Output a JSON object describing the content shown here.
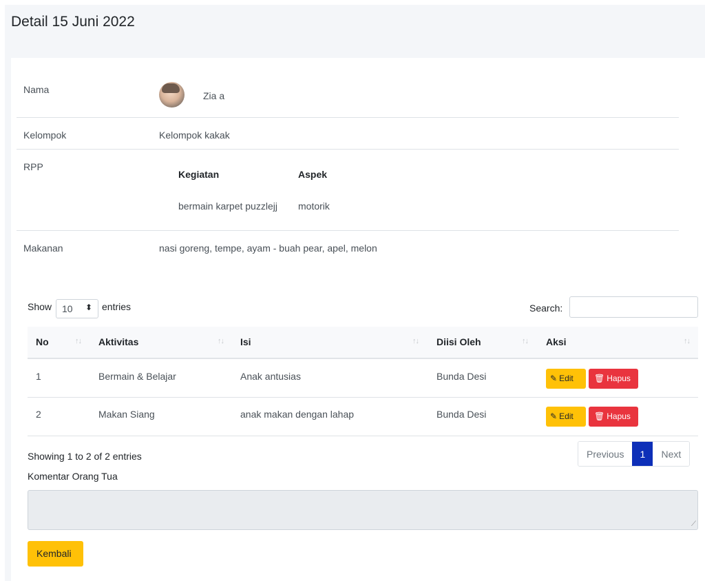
{
  "page": {
    "title": "Detail 15 Juni 2022"
  },
  "detail": {
    "nama_label": "Nama",
    "nama_value": "Zia a",
    "kelompok_label": "Kelompok",
    "kelompok_value": "Kelompok kakak",
    "rpp_label": "RPP",
    "rpp_table": {
      "headers": [
        "Kegiatan",
        "Aspek"
      ],
      "rows": [
        [
          "bermain karpet puzzlejj",
          "motorik"
        ]
      ]
    },
    "makanan_label": "Makanan",
    "makanan_value": "nasi goreng, tempe, ayam - buah pear, apel, melon"
  },
  "datatable": {
    "show_label": "Show",
    "entries_value": "10",
    "entries_label": "entries",
    "search_label": "Search:",
    "search_value": "",
    "sort_icon": "↑↓",
    "columns": [
      "No",
      "Aktivitas",
      "Isi",
      "Diisi Oleh",
      "Aksi"
    ],
    "rows": [
      {
        "no": "1",
        "aktivitas": "Bermain & Belajar",
        "isi": "Anak antusias",
        "diisi_oleh": "Bunda Desi"
      },
      {
        "no": "2",
        "aktivitas": "Makan Siang",
        "isi": "anak makan dengan lahap",
        "diisi_oleh": "Bunda Desi"
      }
    ],
    "edit_label": "Edit",
    "hapus_label": "Hapus",
    "info": "Showing 1 to 2 of 2 entries",
    "pagination": {
      "previous": "Previous",
      "current": "1",
      "next": "Next"
    }
  },
  "komentar": {
    "label": "Komentar Orang Tua",
    "value": ""
  },
  "kembali_label": "Kembali",
  "colors": {
    "warning": "#ffc107",
    "danger": "#e9343e",
    "primary": "#0d2fb8",
    "page_bg": "#f4f6f9"
  },
  "icons": {
    "edit": "edit-icon",
    "hapus": "trash-icon",
    "select": "select-caret-icon",
    "sort": "sort-icon"
  }
}
